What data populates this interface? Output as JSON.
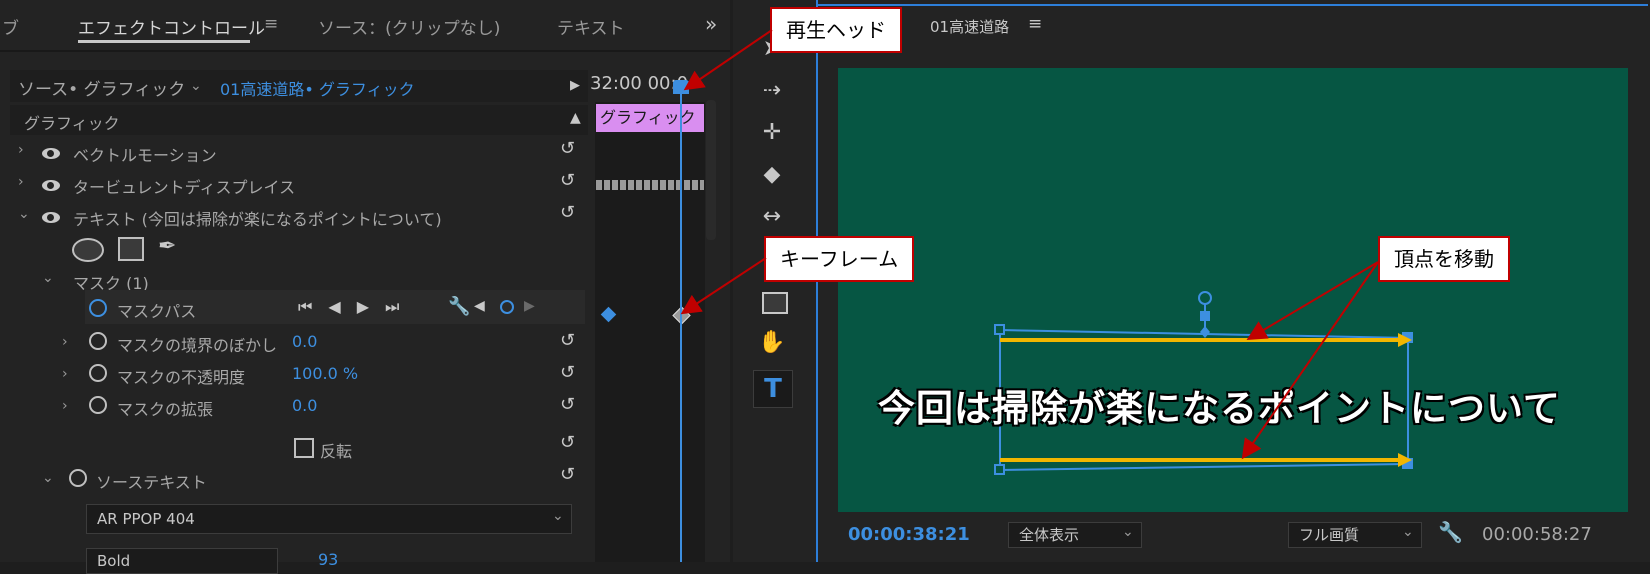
{
  "left_panel": {
    "tabs": [
      "ブ",
      "エフェクトコントロール",
      "ソース：(クリップなし)",
      "テキスト"
    ],
    "menu_glyph": "≡",
    "more_glyph": "»",
    "source_label": "ソース• グラフィック",
    "clip_label": "01高速道路• グラフィック",
    "timecode_header": "32:00 00:0",
    "section_title": "グラフィック",
    "clip_bar_label": "グラフィック",
    "effects": [
      {
        "label": "ベクトルモーション"
      },
      {
        "label": "タービュレントディスプレイス"
      },
      {
        "label": "テキスト (今回は掃除が楽になるポイントについて)"
      }
    ],
    "mask_label": "マスク (1)",
    "mask_path_label": "マスクパス",
    "mask_params": [
      {
        "label": "マスクの境界のぼかし",
        "value": "0.0"
      },
      {
        "label": "マスクの不透明度",
        "value": "100.0 %"
      },
      {
        "label": "マスクの拡張",
        "value": "0.0"
      }
    ],
    "invert_label": "反転",
    "source_text_label": "ソーステキスト",
    "font_value": "AR PPOP 404",
    "font_style_value": "Bold",
    "font_size_partial": "93"
  },
  "program_monitor": {
    "title": "01高速道路",
    "menu_glyph": "≡",
    "overlay_text": "今回は掃除が楽になるポイントについて",
    "current_timecode": "00:00:38:21",
    "zoom_value": "全体表示",
    "quality_value": "フル画質",
    "duration_timecode": "00:00:58:27"
  },
  "callouts": {
    "playhead": "再生ヘッド",
    "keyframe": "キーフレーム",
    "vertex_move": "頂点を移動"
  },
  "colors": {
    "panel_bg": "#232323",
    "accent_blue": "#3d8fe0",
    "video_bg": "#065643",
    "clip_pink": "#d98ef0",
    "arrow_yellow": "#f2b600",
    "callout_red": "#c00000"
  }
}
